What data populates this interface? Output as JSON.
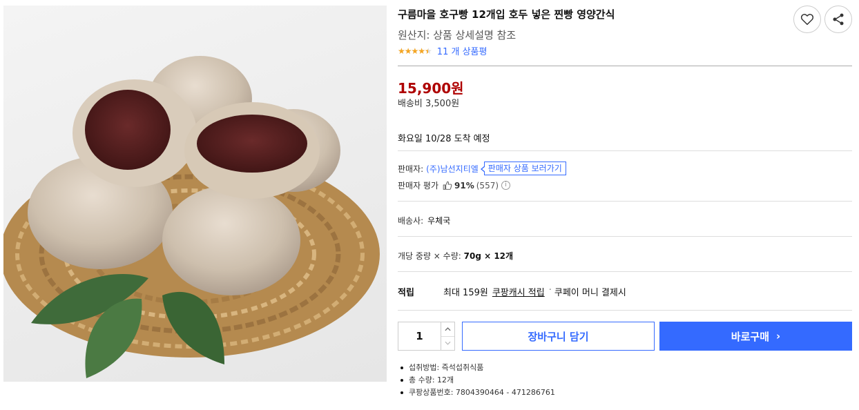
{
  "product": {
    "title": "구름마을 호구빵 12개입 호두 넣은 찐빵 영양간식",
    "origin": "원산지: 상품 상세설명 참조",
    "rating": 4.5,
    "review_count_text": "11 개 상품평",
    "price": "15,900원",
    "shipping_fee": "배송비 3,500원",
    "arrival": "화요일 10/28 도착 예정"
  },
  "actions": {
    "wishlist_icon": "heart-icon",
    "share_icon": "share-icon"
  },
  "seller": {
    "label": "판매자:",
    "name": "(주)남선지티엘",
    "link_label": "판매자 상품 보러가기",
    "rating_label": "판매자 평가",
    "rating_icon": "thumbs-up-icon",
    "rating_pct": "91%",
    "rating_count": "(557)"
  },
  "courier": {
    "label": "배송사:",
    "value": "우체국"
  },
  "spec": {
    "label": "개당 중량 × 수량:",
    "value": "70g × 12개"
  },
  "reward": {
    "label": "적립",
    "amount": "최대 159원",
    "cash_link": "쿠팡캐시 적립",
    "separator": "·",
    "pay_text": "쿠페이 머니 결제시"
  },
  "purchase": {
    "quantity": "1",
    "cart_label": "장바구니 담기",
    "buy_label": "바로구매",
    "buy_chevron": "›"
  },
  "details": [
    "섭취방법: 즉석섭취식품",
    "총 수량: 12개",
    "쿠팡상품번호: 7804390464 - 471286761"
  ],
  "colors": {
    "accent": "#346aff",
    "price": "#ae0000",
    "star": "#f5a623"
  }
}
